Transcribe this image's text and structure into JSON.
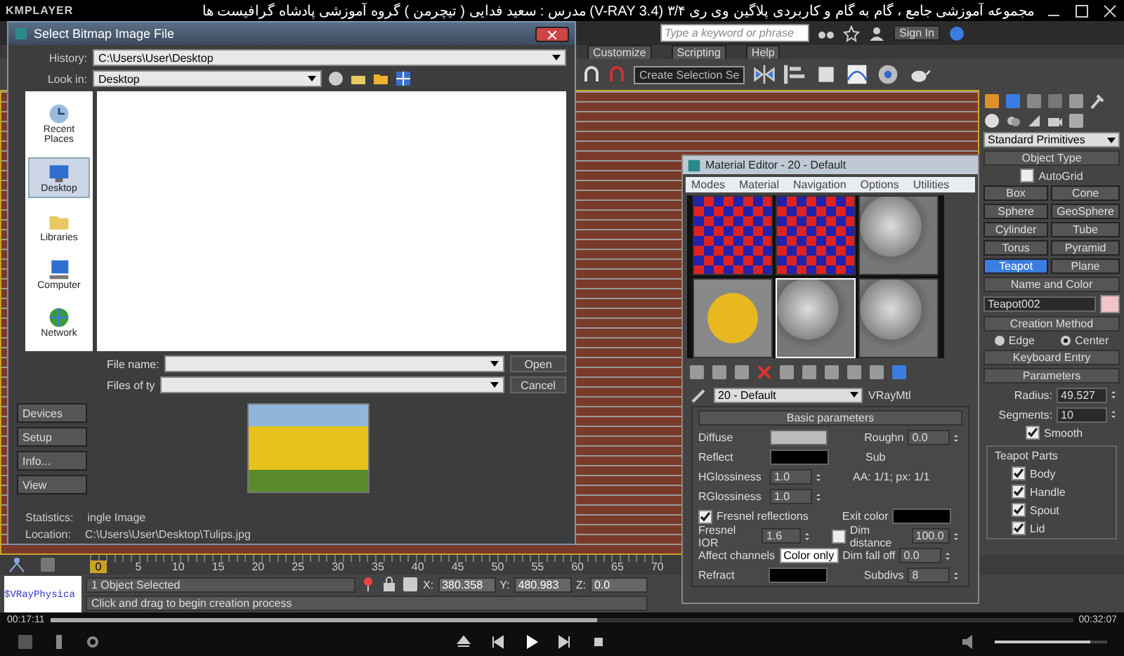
{
  "player": {
    "app_name": "KMPLAYER",
    "title": "مجموعه آموزشی جامع ، گام به گام و کاربردی پلاگین وی ری ۳/۴ (V-RAY 3.4)  مدرس : سعید فدایی ( تیچرمن ) گروه آموزشی پادشاه گرافیست ها",
    "elapsed": "00:17:11",
    "total": "00:32:07",
    "progress": {
      "level": 0.535
    },
    "volume": {
      "level": 0.85
    }
  },
  "max": {
    "search": {
      "placeholder": "Type a keyword or phrase"
    },
    "sign_in": "Sign In",
    "menu": [
      "Customize",
      "Scripting",
      "Help"
    ],
    "selection_set": "Create Selection Se",
    "command_panel": {
      "category": "Standard Primitives",
      "object_type": "Object Type",
      "autogrid": {
        "label": "AutoGrid",
        "checked": false
      },
      "objects": [
        {
          "label": "Box",
          "selected": false
        },
        {
          "label": "Cone",
          "selected": false
        },
        {
          "label": "Sphere",
          "selected": false
        },
        {
          "label": "GeoSphere",
          "selected": false
        },
        {
          "label": "Cylinder",
          "selected": false
        },
        {
          "label": "Tube",
          "selected": false
        },
        {
          "label": "Torus",
          "selected": false
        },
        {
          "label": "Pyramid",
          "selected": false
        },
        {
          "label": "Teapot",
          "selected": true
        },
        {
          "label": "Plane",
          "selected": false
        }
      ],
      "name_and_color": "Name and Color",
      "object_name": "Teapot002",
      "creation_method": "Creation Method",
      "methods": [
        {
          "label": "Edge",
          "selected": false
        },
        {
          "label": "Center",
          "selected": true
        }
      ],
      "keyboard_entry": "Keyboard Entry",
      "parameters": "Parameters",
      "radius": {
        "label": "Radius:",
        "value": "49.527"
      },
      "segments": {
        "label": "Segments:",
        "value": "10"
      },
      "smooth": {
        "label": "Smooth",
        "checked": true
      },
      "parts_title": "Teapot Parts",
      "parts": [
        {
          "label": "Body",
          "checked": true
        },
        {
          "label": "Handle",
          "checked": true
        },
        {
          "label": "Spout",
          "checked": true
        },
        {
          "label": "Lid",
          "checked": true
        }
      ]
    },
    "timeline": {
      "ticks": [
        "0",
        "5",
        "10",
        "15",
        "20",
        "25",
        "30",
        "35",
        "40",
        "45",
        "50",
        "55",
        "60",
        "65",
        "70"
      ]
    },
    "status": {
      "listener": "$VRayPhysica",
      "selection": "1 Object Selected",
      "prompt": "Click and drag to begin creation process",
      "x": {
        "label": "X:",
        "value": "380.358"
      },
      "y": {
        "label": "Y:",
        "value": "480.983"
      },
      "z": {
        "label": "Z:",
        "value": "0.0"
      }
    }
  },
  "bitmap_dialog": {
    "title": "Select Bitmap Image File",
    "history": {
      "label": "History:",
      "value": "C:\\Users\\User\\Desktop"
    },
    "look_in": {
      "label": "Look in:",
      "value": "Desktop"
    },
    "places": [
      {
        "label": "Recent Places",
        "selected": false
      },
      {
        "label": "Desktop",
        "selected": true
      },
      {
        "label": "Libraries",
        "selected": false
      },
      {
        "label": "Computer",
        "selected": false
      },
      {
        "label": "Network",
        "selected": false
      }
    ],
    "file_name_label": "File name:",
    "file_type_label": "Files of ty",
    "open": "Open",
    "cancel": "Cancel",
    "side_buttons": [
      "Devices",
      "Setup",
      "Info...",
      "View"
    ],
    "statistics": {
      "label": "Statistics:",
      "value": "ingle Image"
    },
    "location": {
      "label": "Location:",
      "value": "C:\\Users\\User\\Desktop\\Tulips.jpg"
    }
  },
  "material_editor": {
    "title": "Material Editor - 20 - Default",
    "menu": [
      "Modes",
      "Material",
      "Navigation",
      "Options",
      "Utilities"
    ],
    "slots": [
      {
        "kind": "checker",
        "selected": false
      },
      {
        "kind": "checker",
        "selected": false
      },
      {
        "kind": "plain",
        "selected": false
      },
      {
        "kind": "bitmap",
        "selected": false
      },
      {
        "kind": "plain",
        "selected": true
      },
      {
        "kind": "plain",
        "selected": false
      }
    ],
    "material_name": "20 - Default",
    "material_type": "VRayMtl",
    "rollout": "Basic parameters",
    "diffuse": "Diffuse",
    "roughness": {
      "label": "Roughn",
      "value": "0.0"
    },
    "reflect": "Reflect",
    "subdivs_cut": "Sub",
    "aa": "AA: 1/1; px: 1/1",
    "hglossiness": {
      "label": "HGlossiness",
      "value": "1.0"
    },
    "rglossiness": {
      "label": "RGlossiness",
      "value": "1.0"
    },
    "fresnel": {
      "label": "Fresnel reflections",
      "checked": true
    },
    "exit_color": "Exit color",
    "fresnel_ior": {
      "label": "Fresnel IOR",
      "value": "1.6"
    },
    "dim_distance": {
      "label": "Dim distance",
      "checked": false,
      "value": "100.0"
    },
    "affect_channels": {
      "label": "Affect channels",
      "value": "Color only"
    },
    "dim_falloff": {
      "label": "Dim fall off",
      "value": "0.0"
    },
    "refract": "Refract",
    "subdivs": {
      "label": "Subdivs",
      "value": "8"
    }
  }
}
